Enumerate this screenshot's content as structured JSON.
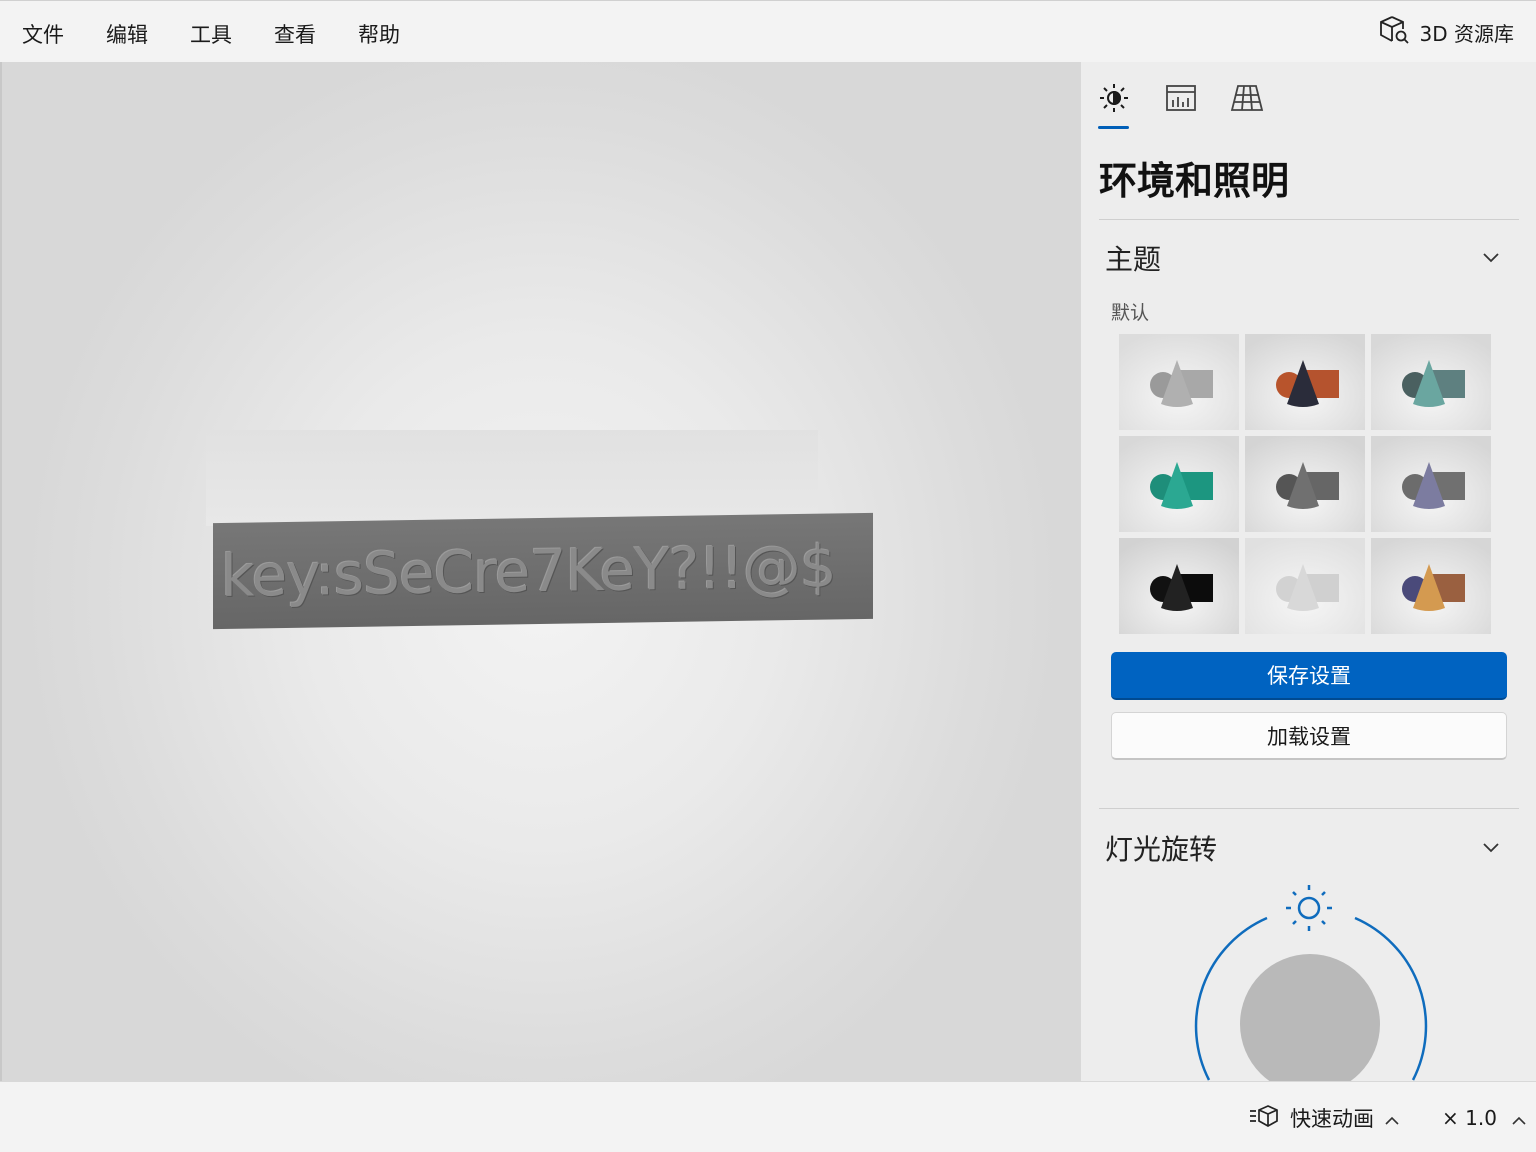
{
  "menu": {
    "items": [
      {
        "label": "文件"
      },
      {
        "label": "编辑"
      },
      {
        "label": "工具"
      },
      {
        "label": "查看"
      },
      {
        "label": "帮助"
      }
    ],
    "library_label": "3D 资源库",
    "library_icon": "cube-search-icon"
  },
  "viewport": {
    "model_text": "key:sSeCre7KeY?!!@$"
  },
  "panel": {
    "tabs": [
      {
        "name": "sun-icon",
        "selected": true
      },
      {
        "name": "stats-icon",
        "selected": false
      },
      {
        "name": "grid-icon",
        "selected": false
      }
    ],
    "title": "环境和照明",
    "theme_section": {
      "heading": "主题",
      "selected_name": "默认",
      "selected_index": 0,
      "themes": [
        {
          "bg": "#dcdcdc",
          "sphere": "#9a9a9a",
          "cone": "#b0b0b0",
          "box": "#a8a8a8"
        },
        {
          "bg": "#d6d6d6",
          "sphere": "#b8542c",
          "cone": "#2a2c3a",
          "box": "#b5532e"
        },
        {
          "bg": "#d8d8d8",
          "sphere": "#4a6060",
          "cone": "#6aa6a0",
          "box": "#5e8080"
        },
        {
          "bg": "#d8d8d8",
          "sphere": "#1e8e7a",
          "cone": "#2ba892",
          "box": "#1c9680"
        },
        {
          "bg": "#d4d4d4",
          "sphere": "#555555",
          "cone": "#707070",
          "box": "#666666"
        },
        {
          "bg": "#d6d6d6",
          "sphere": "#6c6c6c",
          "cone": "#7c7ca0",
          "box": "#707070"
        },
        {
          "bg": "#d2d2d2",
          "sphere": "#111111",
          "cone": "#222222",
          "box": "#0c0c0c"
        },
        {
          "bg": "#e0e0e0",
          "sphere": "#d2d2d2",
          "cone": "#d8d8d8",
          "box": "#d0d0d0"
        },
        {
          "bg": "#d6d6d6",
          "sphere": "#4a4a7a",
          "cone": "#d49a50",
          "box": "#9a6040"
        }
      ],
      "save_label": "保存设置",
      "load_label": "加载设置"
    },
    "light_section": {
      "heading": "灯光旋转"
    }
  },
  "status": {
    "animation_label": "快速动画",
    "speed_label": "× 1.0"
  },
  "colors": {
    "accent": "#0063c1",
    "dial": "#0f6cbd"
  }
}
